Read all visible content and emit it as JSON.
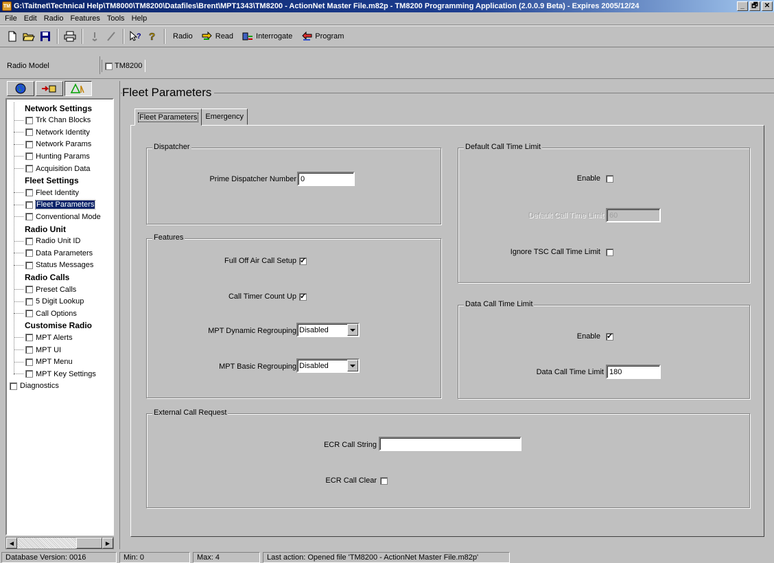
{
  "window": {
    "title": "G:\\Taitnet\\Technical Help\\TM8000\\TM8200\\Datafiles\\Brent\\MPT1343\\TM8200 - ActionNet Master File.m82p - TM8200 Programming Application (2.0.0.9 Beta) - Expires 2005/12/24",
    "icon_text": "TM",
    "controls": [
      "_",
      "🗗",
      "✕"
    ]
  },
  "menu": [
    "File",
    "Edit",
    "Radio",
    "Features",
    "Tools",
    "Help"
  ],
  "toolbar": {
    "icons": [
      "new-icon",
      "open-icon",
      "save-icon",
      "print-icon",
      "tools-icon",
      "check-icon",
      "help-pointer-icon",
      "help-icon"
    ],
    "radio_label": "Radio",
    "read_label": "Read",
    "interrogate_label": "Interrogate",
    "program_label": "Program"
  },
  "model_bar": {
    "label": "Radio Model",
    "model": "TM8200"
  },
  "tree": {
    "groups": [
      {
        "header": "Network Settings",
        "items": [
          "Trk Chan Blocks",
          "Network Identity",
          "Network Params",
          "Hunting Params",
          "Acquisition Data"
        ]
      },
      {
        "header": "Fleet Settings",
        "items": [
          "Fleet Identity",
          "Fleet Parameters",
          "Conventional Mode"
        ]
      },
      {
        "header": "Radio Unit",
        "items": [
          "Radio Unit ID",
          "Data Parameters",
          "Status Messages"
        ]
      },
      {
        "header": "Radio Calls",
        "items": [
          "Preset Calls",
          "5 Digit Lookup",
          "Call Options"
        ]
      },
      {
        "header": "Customise Radio",
        "items": [
          "MPT Alerts",
          "MPT UI",
          "MPT Menu",
          "MPT Key Settings"
        ]
      }
    ],
    "root_items": [
      "Diagnostics"
    ],
    "selected": "Fleet Parameters"
  },
  "main": {
    "frame_title": "Fleet Parameters",
    "tabs": [
      "Fleet Parameters",
      "Emergency"
    ],
    "active_tab": "Fleet Parameters",
    "dispatcher": {
      "title": "Dispatcher",
      "prime_label": "Prime Dispatcher Number",
      "prime_value": "0"
    },
    "features": {
      "title": "Features",
      "full_off_air_label": "Full Off Air Call Setup",
      "full_off_air_checked": true,
      "call_timer_label": "Call Timer Count Up",
      "call_timer_checked": true,
      "dynamic_label": "MPT Dynamic Regrouping",
      "dynamic_value": "Disabled",
      "basic_label": "MPT Basic Regrouping",
      "basic_value": "Disabled"
    },
    "default_call": {
      "title": "Default Call Time Limit",
      "enable_label": "Enable",
      "enable_checked": false,
      "limit_label": "Default Call Time Limit",
      "limit_value": "60",
      "ignore_label": "Ignore TSC Call Time Limit",
      "ignore_checked": false
    },
    "data_call": {
      "title": "Data Call Time Limit",
      "enable_label": "Enable",
      "enable_checked": true,
      "limit_label": "Data Call Time Limit",
      "limit_value": "180"
    },
    "ecr": {
      "title": "External Call Request",
      "string_label": "ECR Call String",
      "string_value": "",
      "clear_label": "ECR Call Clear",
      "clear_checked": false
    }
  },
  "status": {
    "db_version": "Database Version: 0016",
    "min": "Min: 0",
    "max": "Max: 4",
    "last_action": "Last action: Opened file 'TM8200 - ActionNet Master File.m82p'"
  }
}
